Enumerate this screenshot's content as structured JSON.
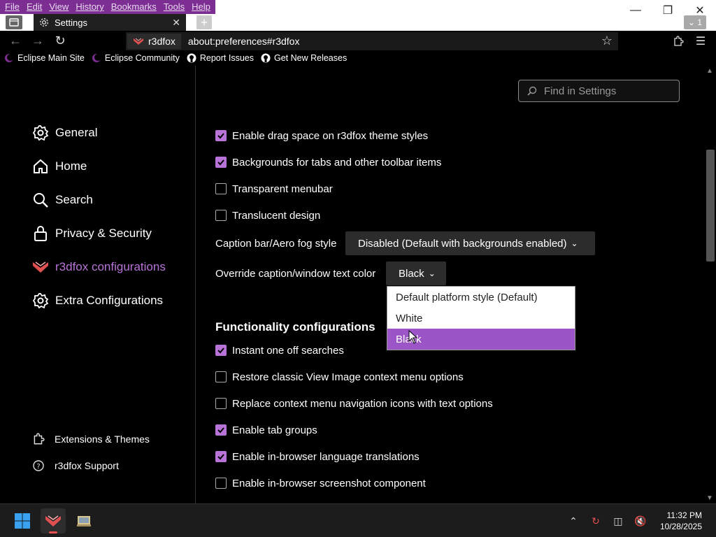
{
  "menu": [
    "File",
    "Edit",
    "View",
    "History",
    "Bookmarks",
    "Tools",
    "Help"
  ],
  "tab": {
    "title": "Settings"
  },
  "tabs_count": "1",
  "urlbar": {
    "identity": "r3dfox",
    "url": "about:preferences#r3dfox"
  },
  "bookmarks": [
    {
      "label": "Eclipse Main Site",
      "icon": "eclipse-icon"
    },
    {
      "label": "Eclipse Community",
      "icon": "eclipse-icon"
    },
    {
      "label": "Report Issues",
      "icon": "github-icon"
    },
    {
      "label": "Get New Releases",
      "icon": "github-icon"
    }
  ],
  "search": {
    "placeholder": "Find in Settings"
  },
  "sidebar": {
    "categories": [
      {
        "label": "General",
        "icon": "gear-icon"
      },
      {
        "label": "Home",
        "icon": "home-icon"
      },
      {
        "label": "Search",
        "icon": "search-icon"
      },
      {
        "label": "Privacy & Security",
        "icon": "lock-icon"
      },
      {
        "label": "r3dfox configurations",
        "icon": "r3dfox-icon",
        "selected": true
      },
      {
        "label": "Extra Configurations",
        "icon": "gear-icon"
      }
    ],
    "footer": [
      {
        "label": "Extensions & Themes",
        "icon": "puzzle-icon"
      },
      {
        "label": "r3dfox Support",
        "icon": "help-icon"
      }
    ]
  },
  "prefs_top": [
    {
      "label": "Enable drag space on r3dfox theme styles",
      "checked": true
    },
    {
      "label": "Backgrounds for tabs and other toolbar items",
      "checked": true
    },
    {
      "label": "Transparent menubar",
      "checked": false
    },
    {
      "label": "Translucent design",
      "checked": false
    }
  ],
  "caption_style": {
    "label": "Caption bar/Aero fog style",
    "value": "Disabled (Default with backgrounds enabled)"
  },
  "override_color": {
    "label": "Override caption/window text color",
    "value": "Black",
    "options": [
      "Default platform style (Default)",
      "White",
      "Black"
    ]
  },
  "functionality": {
    "title": "Functionality configurations",
    "prefs": [
      {
        "label": "Instant one off searches",
        "checked": true
      },
      {
        "label": "Restore classic View Image context menu options",
        "checked": false
      },
      {
        "label": "Replace context menu navigation icons with text options",
        "checked": false
      },
      {
        "label": "Enable tab groups",
        "checked": true
      },
      {
        "label": "Enable in-browser language translations",
        "checked": true
      },
      {
        "label": "Enable in-browser screenshot component",
        "checked": false
      }
    ]
  },
  "clock": {
    "time": "11:32 PM",
    "date": "10/28/2025"
  },
  "colors": {
    "accent": "#b873d8",
    "selected_option": "#9b55c7",
    "menubar": "#7d2e93"
  }
}
